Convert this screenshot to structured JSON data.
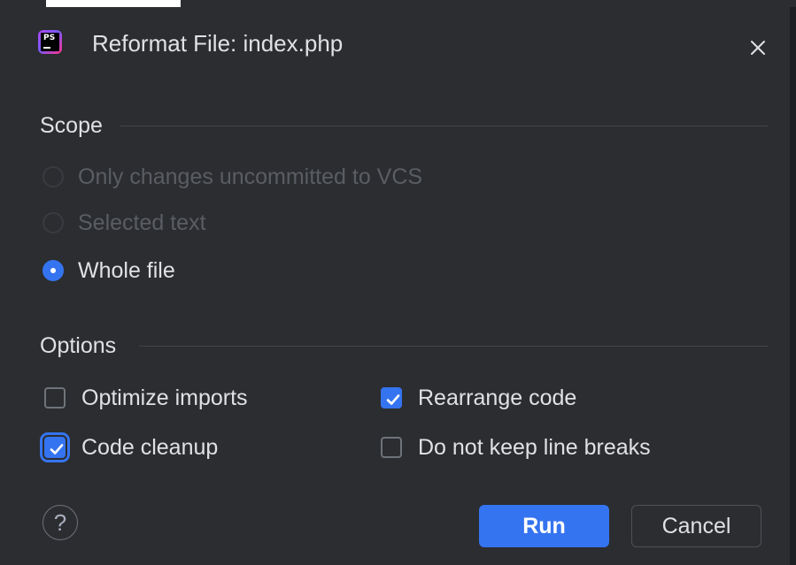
{
  "dialog": {
    "title": "Reformat File: index.php",
    "app_icon": "phpstorm-icon",
    "app_icon_text": "PS",
    "close_icon": "close-icon"
  },
  "scope": {
    "heading": "Scope",
    "options": [
      {
        "label": "Only changes uncommitted to VCS",
        "enabled": false,
        "selected": false
      },
      {
        "label": "Selected text",
        "enabled": false,
        "selected": false
      },
      {
        "label": "Whole file",
        "enabled": true,
        "selected": true
      }
    ]
  },
  "options": {
    "heading": "Options",
    "optimize_imports": {
      "label": "Optimize imports",
      "checked": false
    },
    "rearrange_code": {
      "label": "Rearrange code",
      "checked": true
    },
    "code_cleanup": {
      "label": "Code cleanup",
      "checked": true,
      "focused": true
    },
    "no_keep_line_breaks": {
      "label": "Do not keep line breaks",
      "checked": false
    }
  },
  "footer": {
    "help_label": "?",
    "run_label": "Run",
    "cancel_label": "Cancel"
  },
  "colors": {
    "background": "#2b2d30",
    "accent": "#3574f0",
    "text": "#dfe1e5",
    "disabled_text": "#5a5d63"
  }
}
